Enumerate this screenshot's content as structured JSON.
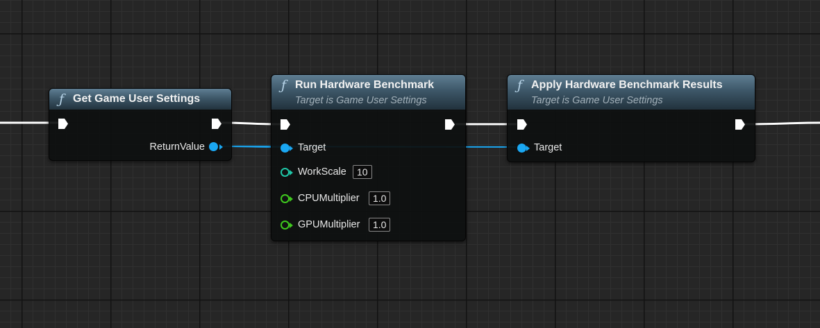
{
  "nodes": {
    "get_settings": {
      "title": "Get Game User Settings",
      "icon": "function-icon",
      "outputs": {
        "return_value": "ReturnValue"
      }
    },
    "run_benchmark": {
      "title": "Run Hardware Benchmark",
      "subtitle": "Target is Game User Settings",
      "icon": "function-icon",
      "inputs": {
        "target": "Target",
        "work_scale": {
          "label": "WorkScale",
          "value": "10"
        },
        "cpu_multiplier": {
          "label": "CPUMultiplier",
          "value": "1.0"
        },
        "gpu_multiplier": {
          "label": "GPUMultiplier",
          "value": "1.0"
        }
      }
    },
    "apply_results": {
      "title": "Apply Hardware Benchmark Results",
      "subtitle": "Target is Game User Settings",
      "icon": "function-icon",
      "inputs": {
        "target": "Target"
      }
    }
  },
  "colors": {
    "exec_wire": "#ffffff",
    "object_wire": "#1aa7f2",
    "int_pin": "#1fc7a8",
    "float_pin": "#3fc91e",
    "header_top": "#5f7e93",
    "header_bottom": "#22323d"
  }
}
